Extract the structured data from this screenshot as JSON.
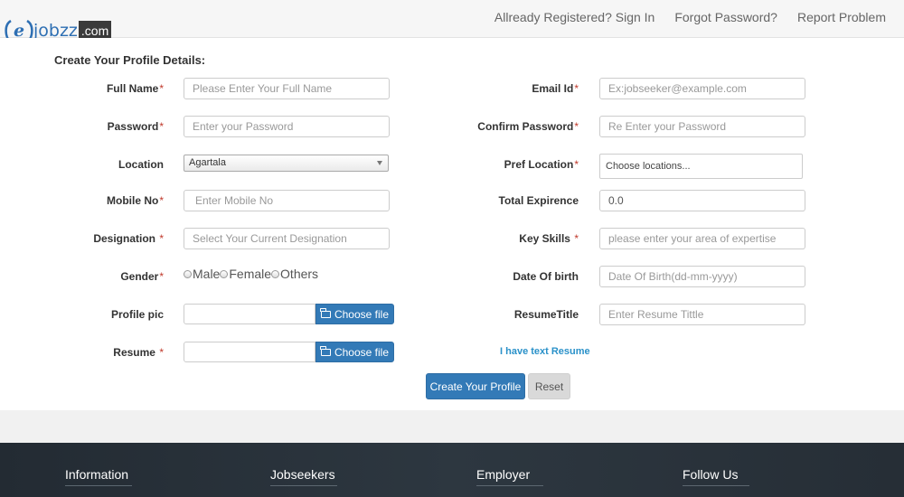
{
  "header": {
    "logo_text": "jobzz",
    "logo_suffix": ".com",
    "nav": [
      "Allready Registered? Sign In",
      "Forgot Password?",
      "Report Problem"
    ]
  },
  "form": {
    "title": "Create Your Profile Details:",
    "full_name": {
      "label": "Full Name",
      "required": "*",
      "placeholder": "Please Enter Your Full Name"
    },
    "email": {
      "label": "Email Id",
      "required": "*",
      "placeholder": "Ex:jobseeker@example.com"
    },
    "password": {
      "label": "Password",
      "required": "*",
      "placeholder": "Enter your Password"
    },
    "confirm_password": {
      "label": "Confirm Password",
      "required": "*",
      "placeholder": "Re Enter your Password"
    },
    "location": {
      "label": "Location",
      "selected": "Agartala"
    },
    "pref_location": {
      "label": "Pref Location",
      "required": "*",
      "value": "Choose  locations..."
    },
    "mobile": {
      "label": "Mobile No",
      "required": "*",
      "placeholder": "Enter Mobile No"
    },
    "experience": {
      "label": "Total Expirence",
      "value": "0.0"
    },
    "designation": {
      "label": "Designation",
      "required": "*",
      "placeholder": "Select Your Current Designation"
    },
    "key_skills": {
      "label": "Key Skills",
      "required": "*",
      "placeholder": "please enter your area of expertise"
    },
    "gender": {
      "label": "Gender",
      "required": "*",
      "options": [
        "Male",
        "Female",
        "Others"
      ]
    },
    "dob": {
      "label": "Date Of birth",
      "placeholder": "Date Of Birth(dd-mm-yyyy)"
    },
    "profile_pic": {
      "label": "Profile pic",
      "button": "Choose file"
    },
    "resume_title": {
      "label": "ResumeTitle",
      "placeholder": "Enter Resume Tittle"
    },
    "resume": {
      "label": "Resume",
      "required": "*",
      "button": "Choose file"
    },
    "text_resume_link": "I have text Resume",
    "submit_label": "Create Your Profile",
    "reset_label": "Reset"
  },
  "footer": {
    "columns": [
      "Information",
      "Jobseekers",
      "Employer",
      "Follow Us"
    ]
  },
  "colors": {
    "primary": "#337ab7",
    "required": "#c0392b",
    "link": "#2a91c9",
    "footer_bg": "#2d3740"
  }
}
